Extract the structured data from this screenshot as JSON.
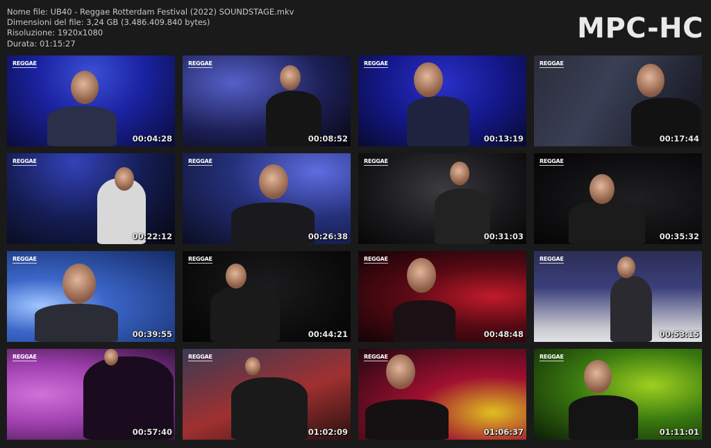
{
  "info": {
    "filename_line": "Nome file: UB40 - Reggae Rotterdam Festival (2022) SOUNDSTAGE.mkv",
    "filesize_line": "Dimensioni del file: 3,24 GB (3.486.409.840 bytes)",
    "resolution_line": "Risoluzione: 1920x1080",
    "duration_line": "Durata: 01:15:27"
  },
  "logo": "MPC-HC",
  "badge": "REGGAE",
  "thumbnails": [
    {
      "timestamp": "00:04:28",
      "bg": "radial-gradient(ellipse at 50% 20%, #3b4fd6 0%, #1a22a0 45%, #0a0c3a 100%)",
      "body": "#2a2f4a"
    },
    {
      "timestamp": "00:08:52",
      "bg": "radial-gradient(ellipse at 30% 30%, #5560c8 0%, #1c1f55 55%, #06060f 100%)",
      "body": "#151515"
    },
    {
      "timestamp": "00:13:19",
      "bg": "radial-gradient(ellipse at 50% 30%, #2a30c8 0%, #14188a 50%, #080a30 100%)",
      "body": "#1e2340"
    },
    {
      "timestamp": "00:17:44",
      "bg": "linear-gradient(120deg, #2a2c3a 0%, #3a3f55 40%, #101218 100%)",
      "body": "#121212"
    },
    {
      "timestamp": "00:22:12",
      "bg": "radial-gradient(ellipse at 40% 10%, #3342b8 0%, #141c52 50%, #06070f 100%)",
      "body": "#d8d8d8"
    },
    {
      "timestamp": "00:26:38",
      "bg": "radial-gradient(ellipse at 80% 20%, #5d6de0 0%, #25307a 45%, #0a0c22 100%)",
      "body": "#1a1a1e"
    },
    {
      "timestamp": "00:31:03",
      "bg": "radial-gradient(ellipse at 50% 40%, #3b3b40 0%, #1a1a1d 55%, #060606 100%)",
      "body": "#222"
    },
    {
      "timestamp": "00:35:32",
      "bg": "radial-gradient(ellipse at 60% 50%, #1f1f22 0%, #0c0c0e 70%, #050505 100%)",
      "body": "#1b1b1b"
    },
    {
      "timestamp": "00:39:55",
      "bg": "radial-gradient(ellipse at 20% 60%, #9fc6ff 0%, #3b66c8 35%, #142a66 100%)",
      "body": "#2a2d36"
    },
    {
      "timestamp": "00:44:21",
      "bg": "radial-gradient(ellipse at 50% 40%, #1c1c1e 0%, #0a0a0b 70%, #050505 100%)",
      "body": "#1a1a1a"
    },
    {
      "timestamp": "00:48:48",
      "bg": "radial-gradient(ellipse at 80% 50%, #c21a2a 0%, #5a0a14 45%, #120306 100%)",
      "body": "#1c1015"
    },
    {
      "timestamp": "00:53:15",
      "bg": "linear-gradient(180deg, #2c2e55 0%, #3a3f7a 40%, #c8c8d0 85%, #e0e0e6 100%)",
      "body": "#2a2a30"
    },
    {
      "timestamp": "00:57:40",
      "bg": "radial-gradient(ellipse at 20% 50%, #d070d8 0%, #a040b0 45%, #3a1440 100%)",
      "body": "#1a0c1e"
    },
    {
      "timestamp": "01:02:09",
      "bg": "linear-gradient(160deg, #3a3a55 0%, #a03030 55%, #2a1010 100%)",
      "body": "#1a1a1a"
    },
    {
      "timestamp": "01:06:37",
      "bg": "radial-gradient(ellipse at 80% 70%, #e0c020 0%, #a01030 40%, #200810 100%)",
      "body": "#151012"
    },
    {
      "timestamp": "01:11:01",
      "bg": "radial-gradient(ellipse at 70% 40%, #9fd020 0%, #3a7a10 45%, #0c1e06 100%)",
      "body": "#141414"
    }
  ]
}
